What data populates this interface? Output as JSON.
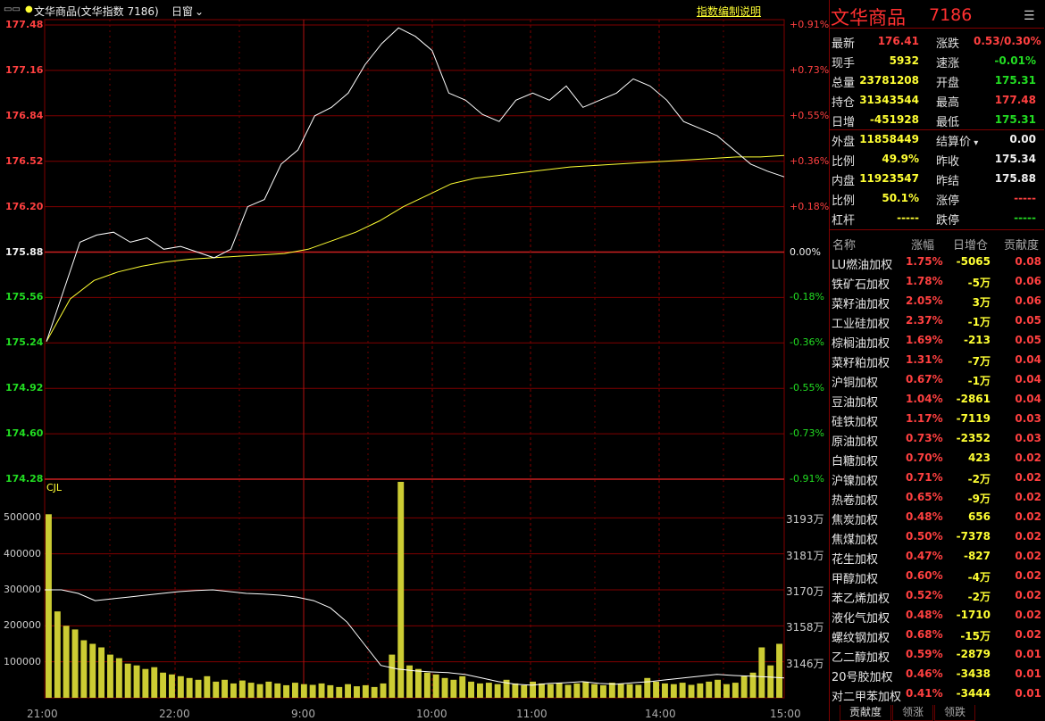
{
  "header": {
    "icon": "layout-toggle-icon",
    "title": "文华商品(文华指数  7186)",
    "window_menu": "日窗",
    "explain_link": "指数编制说明"
  },
  "price_axis": {
    "left": [
      "177.48",
      "177.16",
      "176.84",
      "176.52",
      "176.20",
      "175.88",
      "175.56",
      "175.24",
      "174.92",
      "174.60",
      "174.28"
    ],
    "right": [
      "+0.91%",
      "+0.73%",
      "+0.55%",
      "+0.36%",
      "+0.18%",
      "0.00%",
      "-0.18%",
      "-0.36%",
      "-0.55%",
      "-0.73%",
      "-0.91%"
    ]
  },
  "volume_axis": {
    "label": "CJL",
    "left": [
      "500000",
      "400000",
      "300000",
      "200000",
      "100000"
    ],
    "right": [
      "3193万",
      "3181万",
      "3170万",
      "3158万",
      "3146万"
    ]
  },
  "time_axis": [
    "21:00",
    "22:00",
    "9:00",
    "10:00",
    "11:00",
    "14:00",
    "15:00"
  ],
  "chart_data": {
    "type": "line",
    "x_ticks": [
      "21:00",
      "22:00",
      "9:00",
      "10:00",
      "11:00",
      "14:00",
      "15:00"
    ],
    "ylim": [
      174.28,
      177.48
    ],
    "baseline": 175.88,
    "series": [
      {
        "values": [
          175.25,
          175.6,
          175.95,
          176.0,
          176.02,
          175.95,
          175.98,
          175.9,
          175.92,
          175.88,
          175.84,
          175.9,
          176.2,
          176.25,
          176.5,
          176.6,
          176.84,
          176.9,
          177.0,
          177.2,
          177.35,
          177.46,
          177.4,
          177.3,
          177.0,
          176.95,
          176.85,
          176.8,
          176.95,
          177.0,
          176.95,
          177.05,
          176.9,
          176.95,
          177.0,
          177.1,
          177.05,
          176.95,
          176.8,
          176.75,
          176.7,
          176.6,
          176.5,
          176.45,
          176.41
        ]
      },
      {
        "values": [
          175.25,
          175.55,
          175.68,
          175.74,
          175.78,
          175.81,
          175.83,
          175.84,
          175.85,
          175.86,
          175.87,
          175.9,
          175.96,
          176.02,
          176.1,
          176.2,
          176.28,
          176.36,
          176.4,
          176.42,
          176.44,
          176.46,
          176.48,
          176.49,
          176.5,
          176.51,
          176.52,
          176.53,
          176.54,
          176.55,
          176.55,
          176.56
        ]
      }
    ],
    "volume": {
      "bars": [
        510000,
        240000,
        200000,
        190000,
        160000,
        150000,
        140000,
        120000,
        110000,
        95000,
        90000,
        80000,
        85000,
        70000,
        65000,
        60000,
        55000,
        50000,
        60000,
        45000,
        50000,
        40000,
        48000,
        42000,
        38000,
        45000,
        40000,
        35000,
        42000,
        38000,
        36000,
        40000,
        35000,
        30000,
        38000,
        32000,
        35000,
        30000,
        40000,
        120000,
        600000,
        90000,
        80000,
        70000,
        65000,
        55000,
        50000,
        60000,
        45000,
        40000,
        42000,
        38000,
        50000,
        40000,
        35000,
        45000,
        40000,
        38000,
        42000,
        36000,
        40000,
        45000,
        38000,
        35000,
        42000,
        40000,
        38000,
        36000,
        55000,
        45000,
        40000,
        38000,
        42000,
        36000,
        40000,
        45000,
        50000,
        38000,
        42000,
        60000,
        70000,
        140000,
        90000,
        150000
      ],
      "holding_line": [
        300000,
        300000,
        290000,
        270000,
        275000,
        280000,
        285000,
        290000,
        295000,
        298000,
        300000,
        295000,
        290000,
        288000,
        285000,
        280000,
        270000,
        250000,
        210000,
        150000,
        90000,
        80000,
        75000,
        72000,
        70000,
        65000,
        55000,
        45000,
        38000,
        35000,
        40000,
        42000,
        45000,
        40000,
        38000,
        42000,
        45000,
        50000,
        55000,
        60000,
        65000,
        62000,
        60000,
        58000,
        55000
      ]
    }
  },
  "quote": {
    "name": "文华商品",
    "code": "7186",
    "rows": [
      {
        "l1": "最新",
        "v1": "176.41",
        "c1": "#ff4040",
        "l2": "涨跌",
        "v2": "0.53/0.30%",
        "c2": "#ff4040"
      },
      {
        "l1": "现手",
        "v1": "5932",
        "c1": "#ffff33",
        "l2": "速涨",
        "v2": "-0.01%",
        "c2": "#22dd22"
      },
      {
        "l1": "总量",
        "v1": "23781208",
        "c1": "#ffff33",
        "l2": "开盘",
        "v2": "175.31",
        "c2": "#22dd22"
      },
      {
        "l1": "持仓",
        "v1": "31343544",
        "c1": "#ffff33",
        "l2": "最高",
        "v2": "177.48",
        "c2": "#ff4040"
      },
      {
        "l1": "日增",
        "v1": "-451928",
        "c1": "#ffff33",
        "l2": "最低",
        "v2": "175.31",
        "c2": "#22dd22"
      },
      {
        "l1": "外盘",
        "v1": "11858449",
        "c1": "#ffff33",
        "l2": "结算价",
        "v2": "0.00",
        "c2": "#f0f0f0"
      },
      {
        "l1": "比例",
        "v1": "49.9%",
        "c1": "#ffff33",
        "l2": "昨收",
        "v2": "175.34",
        "c2": "#f0f0f0"
      },
      {
        "l1": "内盘",
        "v1": "11923547",
        "c1": "#ffff33",
        "l2": "昨结",
        "v2": "175.88",
        "c2": "#f0f0f0"
      },
      {
        "l1": "比例",
        "v1": "50.1%",
        "c1": "#ffff33",
        "l2": "涨停",
        "v2": "-----",
        "c2": "#ff4040"
      },
      {
        "l1": "杠杆",
        "v1": "-----",
        "c1": "#ffff33",
        "l2": "跌停",
        "v2": "-----",
        "c2": "#22dd22"
      }
    ]
  },
  "table": {
    "headers": [
      "名称",
      "涨幅",
      "日增仓",
      "贡献度"
    ],
    "rows": [
      {
        "name": "LU燃油加权",
        "chg": "1.75%",
        "oi": "-5065",
        "contrib": "0.08"
      },
      {
        "name": "铁矿石加权",
        "chg": "1.78%",
        "oi": "-5万",
        "contrib": "0.06"
      },
      {
        "name": "菜籽油加权",
        "chg": "2.05%",
        "oi": "3万",
        "contrib": "0.06"
      },
      {
        "name": "工业硅加权",
        "chg": "2.37%",
        "oi": "-1万",
        "contrib": "0.05"
      },
      {
        "name": "棕榈油加权",
        "chg": "1.69%",
        "oi": "-213",
        "contrib": "0.05"
      },
      {
        "name": "菜籽粕加权",
        "chg": "1.31%",
        "oi": "-7万",
        "contrib": "0.04"
      },
      {
        "name": "沪铜加权",
        "chg": "0.67%",
        "oi": "-1万",
        "contrib": "0.04"
      },
      {
        "name": "豆油加权",
        "chg": "1.04%",
        "oi": "-2861",
        "contrib": "0.04"
      },
      {
        "name": "硅铁加权",
        "chg": "1.17%",
        "oi": "-7119",
        "contrib": "0.03"
      },
      {
        "name": "原油加权",
        "chg": "0.73%",
        "oi": "-2352",
        "contrib": "0.03"
      },
      {
        "name": "白糖加权",
        "chg": "0.70%",
        "oi": "423",
        "contrib": "0.02"
      },
      {
        "name": "沪镍加权",
        "chg": "0.71%",
        "oi": "-2万",
        "contrib": "0.02"
      },
      {
        "name": "热卷加权",
        "chg": "0.65%",
        "oi": "-9万",
        "contrib": "0.02"
      },
      {
        "name": "焦炭加权",
        "chg": "0.48%",
        "oi": "656",
        "contrib": "0.02"
      },
      {
        "name": "焦煤加权",
        "chg": "0.50%",
        "oi": "-7378",
        "contrib": "0.02"
      },
      {
        "name": "花生加权",
        "chg": "0.47%",
        "oi": "-827",
        "contrib": "0.02"
      },
      {
        "name": "甲醇加权",
        "chg": "0.60%",
        "oi": "-4万",
        "contrib": "0.02"
      },
      {
        "name": "苯乙烯加权",
        "chg": "0.52%",
        "oi": "-2万",
        "contrib": "0.02"
      },
      {
        "name": "液化气加权",
        "chg": "0.48%",
        "oi": "-1710",
        "contrib": "0.02"
      },
      {
        "name": "螺纹钢加权",
        "chg": "0.68%",
        "oi": "-15万",
        "contrib": "0.02"
      },
      {
        "name": "乙二醇加权",
        "chg": "0.59%",
        "oi": "-2879",
        "contrib": "0.01"
      },
      {
        "name": "20号胶加权",
        "chg": "0.46%",
        "oi": "-3438",
        "contrib": "0.01"
      },
      {
        "name": "对二甲苯加权",
        "chg": "0.41%",
        "oi": "-3444",
        "contrib": "0.01"
      }
    ]
  },
  "tabs": [
    "贡献度",
    "领涨",
    "领跌"
  ],
  "colors": {
    "up": "#ff4040",
    "down": "#22dd22",
    "grid": "#800000",
    "price": "#ffffff",
    "avg": "#ffff33",
    "bar": "#cccc33"
  }
}
